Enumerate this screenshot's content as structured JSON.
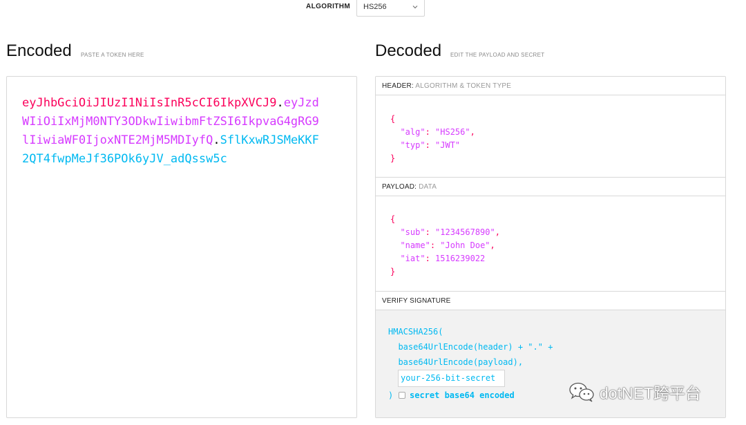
{
  "algorithm": {
    "label": "ALGORITHM",
    "selected": "HS256"
  },
  "encoded": {
    "title": "Encoded",
    "subtitle": "PASTE A TOKEN HERE",
    "token": {
      "header": "eyJhbGciOiJIUzI1NiIsInR5cCI6IkpXVCJ9",
      "dot": ".",
      "payload": "eyJzdWIiOiIxMjM0NTY3ODkwIiwibmFtZSI6IkpvaG4gRG9lIiwiaWF0IjoxNTE2MjM5MDIyfQ",
      "signature": "SflKxwRJSMeKKF2QT4fwpMeJf36POk6yJV_adQssw5c"
    }
  },
  "decoded": {
    "title": "Decoded",
    "subtitle": "EDIT THE PAYLOAD AND SECRET",
    "header_panel": {
      "label": "HEADER:",
      "sublabel": "ALGORITHM & TOKEN TYPE",
      "fields": [
        {
          "key": "\"alg\"",
          "value": "\"HS256\"",
          "sep": ": ",
          "end": ","
        },
        {
          "key": "\"typ\"",
          "value": "\"JWT\"",
          "sep": ": ",
          "end": ""
        }
      ]
    },
    "payload_panel": {
      "label": "PAYLOAD:",
      "sublabel": "DATA",
      "fields": [
        {
          "key": "\"sub\"",
          "value": "\"1234567890\"",
          "sep": ": ",
          "end": ","
        },
        {
          "key": "\"name\"",
          "value": "\"John Doe\"",
          "sep": ": ",
          "end": ","
        },
        {
          "key": "\"iat\"",
          "value": "1516239022",
          "sep": ": ",
          "end": ""
        }
      ]
    },
    "verify_panel": {
      "label": "VERIFY SIGNATURE",
      "line1": "HMACSHA256(",
      "line2": "  base64UrlEncode(header) + \".\" +",
      "line3": "  base64UrlEncode(payload),",
      "secret_value": "your-256-bit-secret",
      "close_paren": ")",
      "checkbox_label": "secret base64 encoded"
    },
    "open_brace": "{",
    "close_brace": "}"
  },
  "watermark": {
    "text": "dotNET跨平台"
  }
}
